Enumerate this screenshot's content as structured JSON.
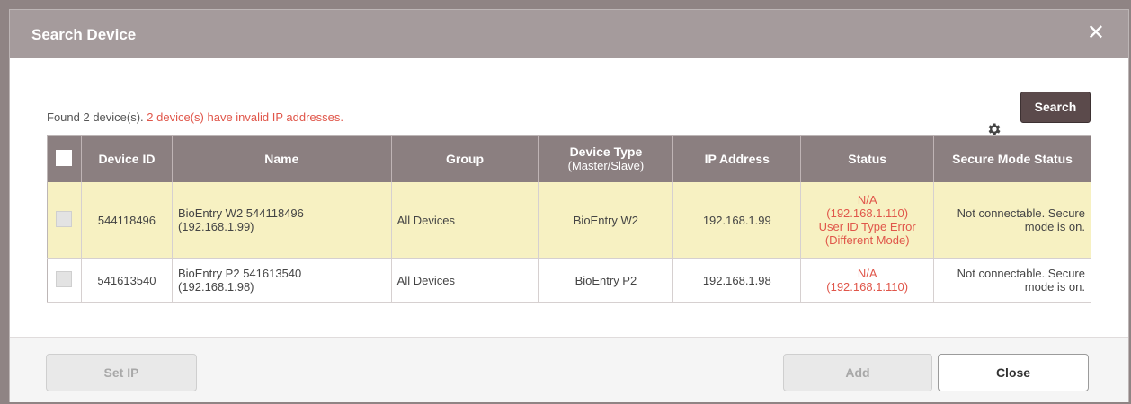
{
  "dialog": {
    "title": "Search Device",
    "close_glyph": "✕"
  },
  "summary": {
    "found_text": "Found 2 device(s).",
    "warning_text": "2 device(s) have invalid IP addresses."
  },
  "toolbar": {
    "search_label": "Search",
    "settings_icon": "gear-icon"
  },
  "table": {
    "headers": {
      "device_id": "Device ID",
      "name": "Name",
      "group": "Group",
      "device_type": "Device Type",
      "device_type_sub": "(Master/Slave)",
      "ip_address": "IP Address",
      "status": "Status",
      "secure_mode": "Secure Mode Status"
    },
    "rows": [
      {
        "device_id": "544118496",
        "name_line1": "BioEntry W2 544118496",
        "name_line2": "(192.168.1.99)",
        "group": "All Devices",
        "device_type": "BioEntry W2",
        "ip_address": "192.168.1.99",
        "status_line1": "N/A",
        "status_line2": "(192.168.1.110)",
        "status_line3": "User ID Type Error",
        "status_line4": "(Different Mode)",
        "secure_line1": "Not connectable. Secure",
        "secure_line2": "mode is on."
      },
      {
        "device_id": "541613540",
        "name_line1": "BioEntry P2 541613540",
        "name_line2": "(192.168.1.98)",
        "group": "All Devices",
        "device_type": "BioEntry P2",
        "ip_address": "192.168.1.98",
        "status_line1": "N/A",
        "status_line2": "(192.168.1.110)",
        "secure_line1": "Not connectable. Secure",
        "secure_line2": "mode is on."
      }
    ]
  },
  "footer": {
    "set_ip_label": "Set IP",
    "add_label": "Add",
    "close_label": "Close"
  },
  "colors": {
    "titlebar": "#a59b9c",
    "header": "#8b7f80",
    "highlight_row": "#f7f1c2",
    "warning": "#e0564a",
    "search_button": "#5b4a4b"
  }
}
